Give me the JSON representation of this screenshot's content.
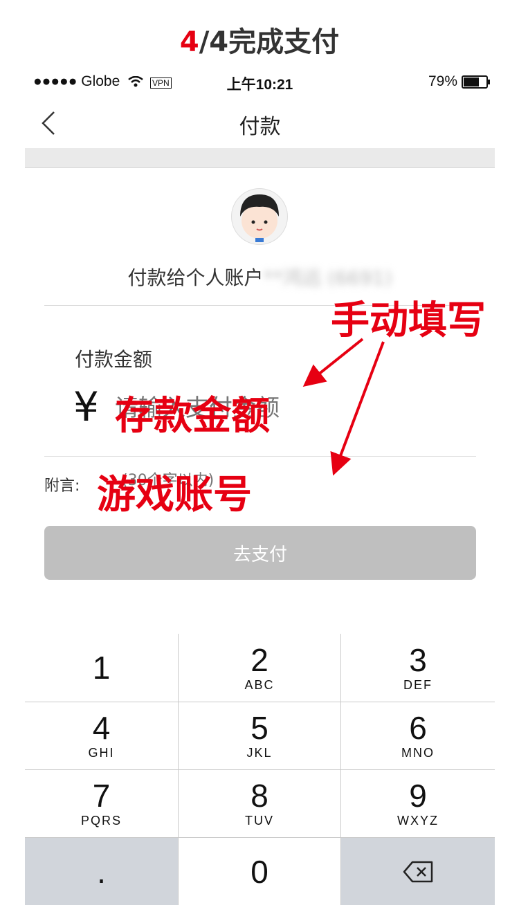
{
  "step_caption": {
    "current": "4",
    "rest": "/4完成支付"
  },
  "status_bar": {
    "carrier": "●●●●● Globe",
    "vpn": "VPN",
    "time": "上午10:21",
    "battery": "79%",
    "battery_level": 0.79
  },
  "nav": {
    "title": "付款"
  },
  "payee": {
    "label": "付款给个人账户",
    "masked_name": "**鸿远 (6691)"
  },
  "amount": {
    "title": "付款金额",
    "currency": "¥",
    "placeholder": "请输入支付金额"
  },
  "note": {
    "label": "附言:",
    "placeholder": "(30个字以内)"
  },
  "pay_button": {
    "label": "去支付"
  },
  "annotations": {
    "fill_manually": "手动填写",
    "deposit_amount": "存款金额",
    "game_account": "游戏账号",
    "color": "#e60012"
  },
  "keypad": [
    {
      "digit": "1",
      "letters": ""
    },
    {
      "digit": "2",
      "letters": "ABC"
    },
    {
      "digit": "3",
      "letters": "DEF"
    },
    {
      "digit": "4",
      "letters": "GHI"
    },
    {
      "digit": "5",
      "letters": "JKL"
    },
    {
      "digit": "6",
      "letters": "MNO"
    },
    {
      "digit": "7",
      "letters": "PQRS"
    },
    {
      "digit": "8",
      "letters": "TUV"
    },
    {
      "digit": "9",
      "letters": "WXYZ"
    },
    {
      "digit": ".",
      "letters": ""
    },
    {
      "digit": "0",
      "letters": ""
    },
    {
      "digit": "",
      "letters": "",
      "icon": "backspace-icon"
    }
  ]
}
